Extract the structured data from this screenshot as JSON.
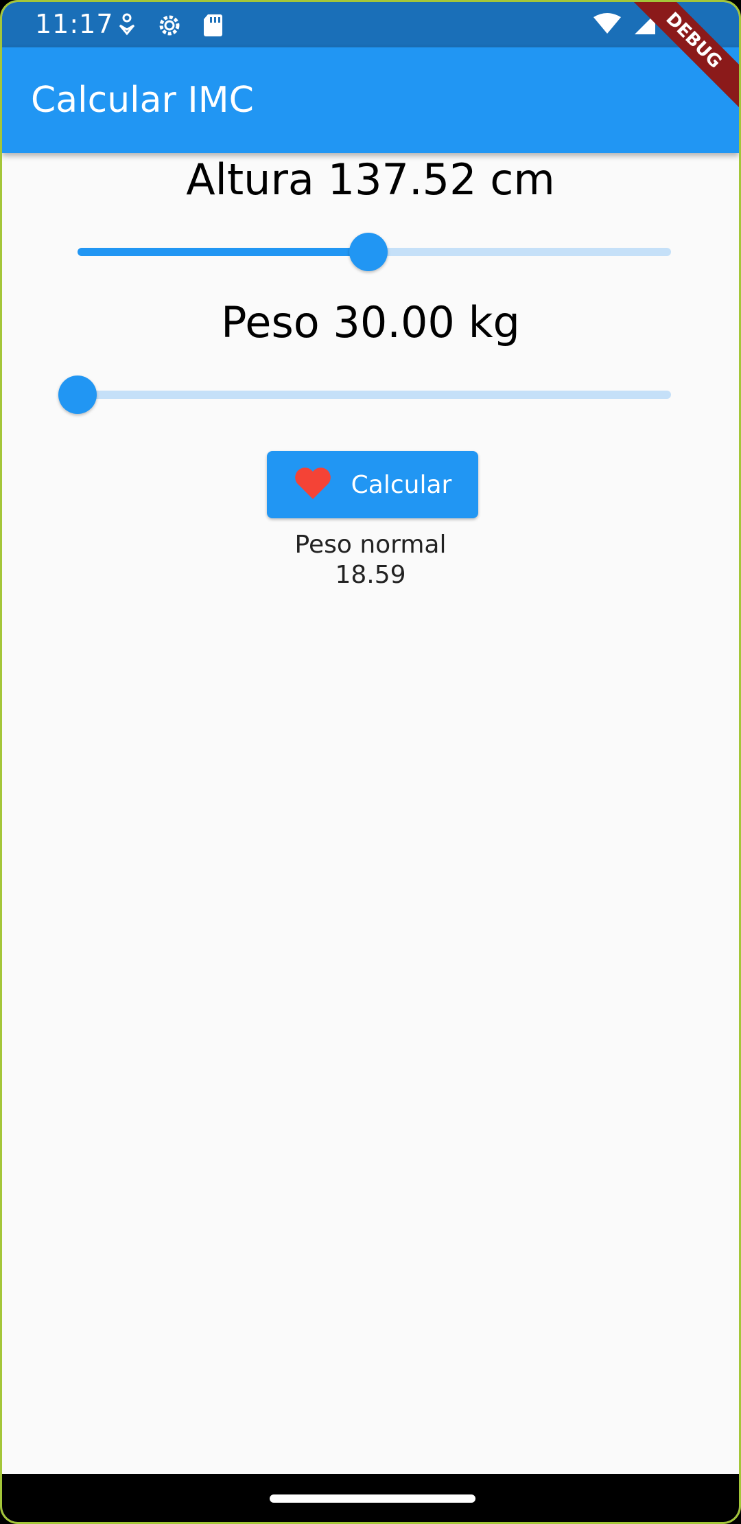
{
  "status_bar": {
    "time": "11:17",
    "left_icons": [
      "accessibility-icon",
      "settings-gear-icon",
      "sd-card-icon"
    ],
    "right_icons": [
      "wifi-icon",
      "cell-signal-icon",
      "battery-icon"
    ]
  },
  "app_bar": {
    "title": "Calcular IMC"
  },
  "debug_banner": {
    "label": "DEBUG"
  },
  "altura": {
    "label": "Altura 137.52 cm",
    "slider_fraction": 0.49
  },
  "peso": {
    "label": "Peso 30.00 kg",
    "slider_fraction": 0.0
  },
  "button": {
    "label": "Calcular",
    "icon": "heart-icon"
  },
  "result": {
    "category": "Peso normal",
    "value": "18.59"
  },
  "colors": {
    "primary": "#2196f3",
    "status_bar": "#1a6fb8",
    "heart": "#f44336",
    "debug_banner": "#8b1a1a"
  }
}
